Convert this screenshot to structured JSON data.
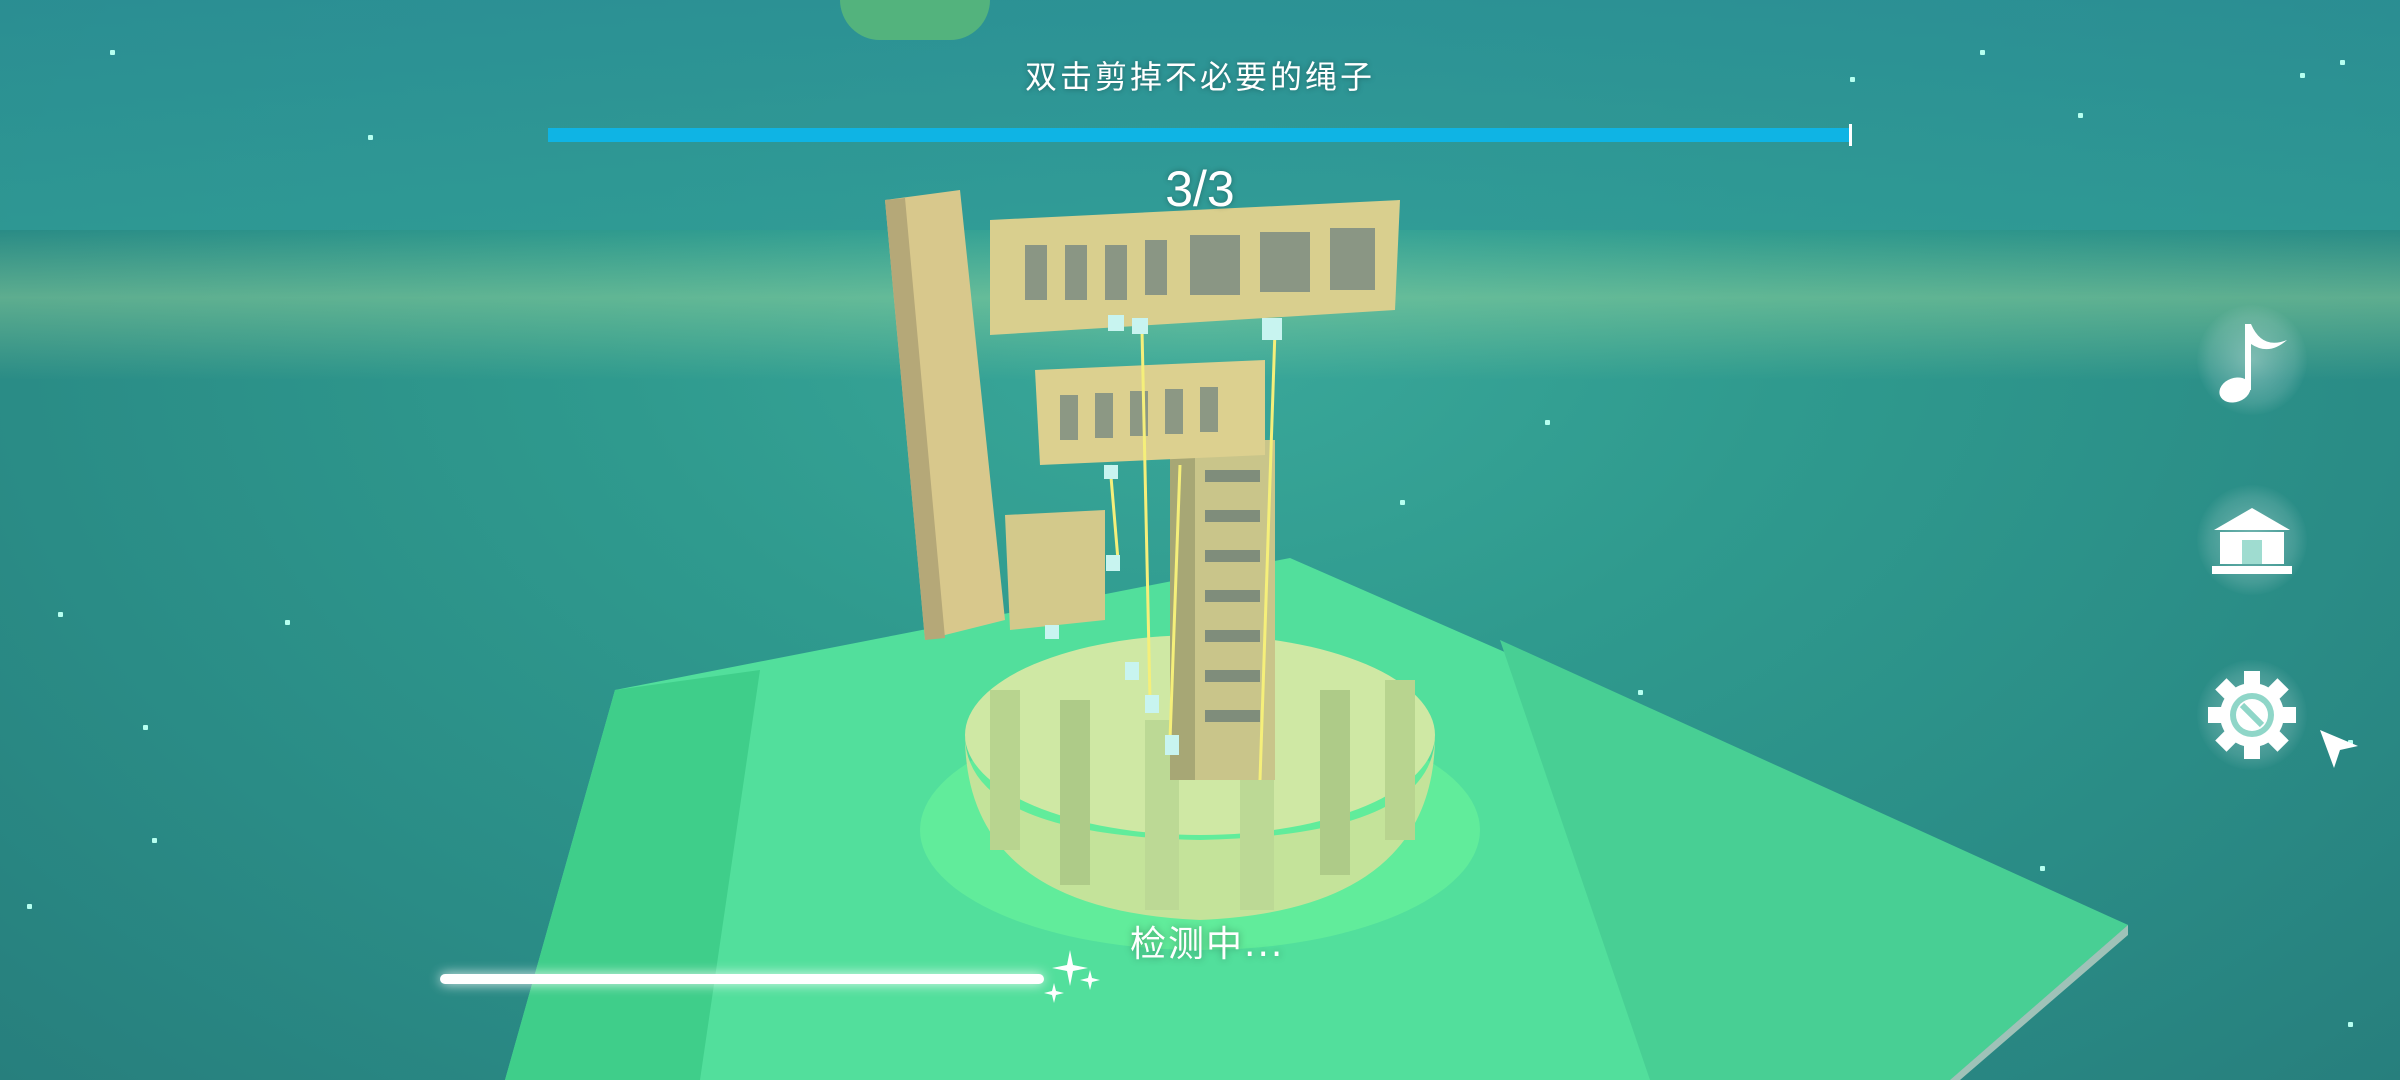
{
  "hud": {
    "instruction": "双击剪掉不必要的绳子",
    "level_counter": "3/3",
    "level_progress": 1.0,
    "status_text": "检测中...",
    "check_progress": 0.5
  },
  "side_menu": {
    "buttons": [
      {
        "icon": "music-note-icon"
      },
      {
        "icon": "gallery-icon"
      },
      {
        "icon": "settings-gear-icon"
      }
    ]
  },
  "colors": {
    "progress_bar": "#0fb4e4",
    "background": "#2f9a8e",
    "island": "#4fe09a",
    "temple": "#d9cf8e",
    "rope": "#f5ef7a"
  }
}
